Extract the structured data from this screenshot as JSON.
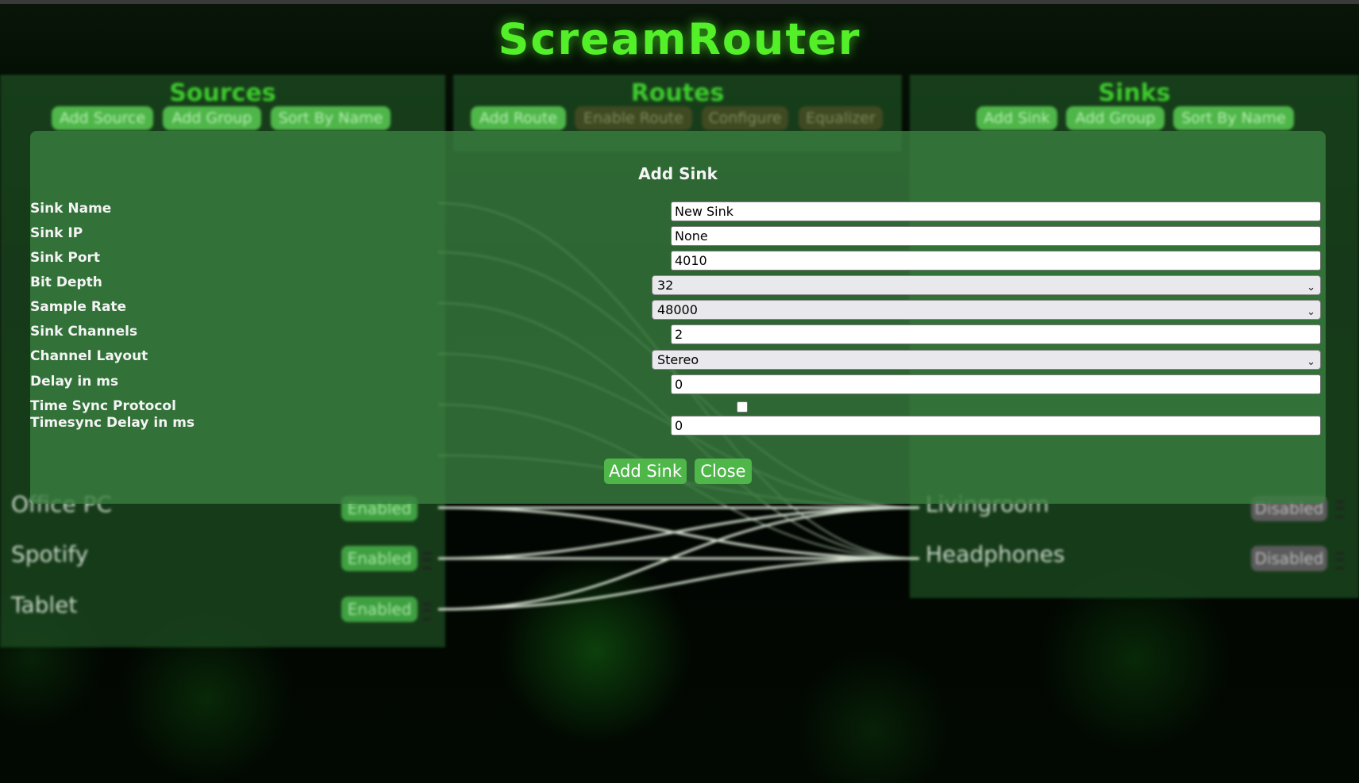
{
  "app": {
    "title": "ScreamRouter"
  },
  "sources": {
    "title": "Sources",
    "buttons": [
      "Add Source",
      "Add Group",
      "Sort By Name"
    ],
    "visible_rows": [
      {
        "label": "Office PC",
        "state": "Enabled"
      },
      {
        "label": "Spotify",
        "state": "Enabled"
      },
      {
        "label": "Tablet",
        "state": "Enabled"
      }
    ]
  },
  "routes": {
    "title": "Routes",
    "buttons": [
      "Add Route",
      "Enable Route",
      "Configure",
      "Equalizer"
    ]
  },
  "sinks": {
    "title": "Sinks",
    "buttons": [
      "Add Sink",
      "Add Group",
      "Sort By Name"
    ],
    "visible_rows": [
      {
        "label": "Livingroom",
        "state": "Disabled"
      },
      {
        "label": "Headphones",
        "state": "Disabled"
      }
    ]
  },
  "modal": {
    "title": "Add Sink",
    "fields": {
      "sink_name": {
        "label": "Sink Name",
        "value": "New Sink"
      },
      "sink_ip": {
        "label": "Sink IP",
        "value": "None"
      },
      "sink_port": {
        "label": "Sink Port",
        "value": "4010"
      },
      "bit_depth": {
        "label": "Bit Depth",
        "value": "32"
      },
      "sample_rate": {
        "label": "Sample Rate",
        "value": "48000"
      },
      "sink_channels": {
        "label": "Sink Channels",
        "value": "2"
      },
      "channel_layout": {
        "label": "Channel Layout",
        "value": "Stereo"
      },
      "delay": {
        "label": "Delay in ms",
        "value": "0"
      },
      "time_sync_protocol": {
        "label": "Time Sync Protocol",
        "checked": false
      },
      "timesync_delay": {
        "label": "Timesync Delay in ms",
        "value": "0"
      }
    },
    "buttons": {
      "submit": "Add Sink",
      "close": "Close"
    }
  },
  "colors": {
    "accent_green": "#53f029",
    "button_green": "#4fb64a",
    "modal_bg": "#3a8040"
  }
}
